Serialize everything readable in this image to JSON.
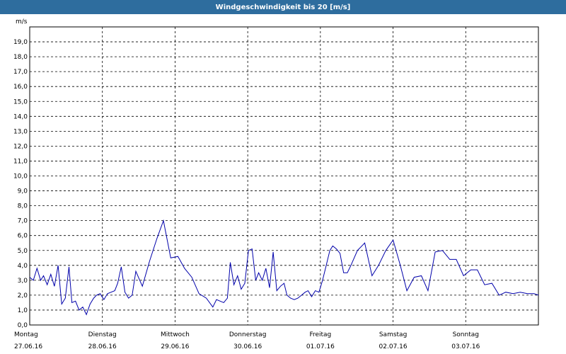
{
  "header": {
    "title": "Windgeschwindigkeit bis 20 [m/s]"
  },
  "chart_data": {
    "type": "line",
    "title": "Windgeschwindigkeit bis 20 [m/s]",
    "ylabel": "m/s",
    "ylim": [
      0,
      20
    ],
    "yticks": [
      "0,0",
      "1,0",
      "2,0",
      "3,0",
      "4,0",
      "5,0",
      "6,0",
      "7,0",
      "8,0",
      "9,0",
      "10,0",
      "11,0",
      "12,0",
      "13,0",
      "14,0",
      "15,0",
      "16,0",
      "17,0",
      "18,0",
      "19,0"
    ],
    "xlim": [
      0,
      7
    ],
    "days": [
      {
        "weekday": "Montag",
        "date": "27.06.16"
      },
      {
        "weekday": "Dienstag",
        "date": "28.06.16"
      },
      {
        "weekday": "Mittwoch",
        "date": "29.06.16"
      },
      {
        "weekday": "Donnerstag",
        "date": "30.06.16"
      },
      {
        "weekday": "Freitag",
        "date": "01.07.16"
      },
      {
        "weekday": "Samstag",
        "date": "02.07.16"
      },
      {
        "weekday": "Sonntag",
        "date": "03.07.16"
      }
    ],
    "grid": true,
    "line_color": "#0000aa",
    "series": [
      {
        "x": [
          0.0,
          0.05,
          0.1,
          0.15,
          0.19,
          0.24,
          0.29,
          0.34,
          0.39,
          0.44,
          0.49,
          0.54,
          0.58,
          0.63,
          0.68,
          0.73,
          0.78,
          0.83,
          0.88,
          0.92,
          0.97,
          1.02,
          1.07,
          1.12,
          1.17,
          1.21,
          1.26,
          1.31,
          1.36,
          1.41,
          1.46,
          1.55,
          1.65,
          1.75,
          1.84,
          1.94,
          2.04,
          2.13,
          2.23,
          2.33,
          2.43,
          2.52,
          2.57,
          2.62,
          2.67,
          2.72,
          2.76,
          2.81,
          2.86,
          2.91,
          2.96,
          3.01,
          3.06,
          3.11,
          3.15,
          3.2,
          3.25,
          3.3,
          3.35,
          3.4,
          3.45,
          3.5,
          3.54,
          3.59,
          3.64,
          3.69,
          3.74,
          3.79,
          3.83,
          3.88,
          3.93,
          3.98,
          4.03,
          4.08,
          4.13,
          4.17,
          4.22,
          4.27,
          4.32,
          4.37,
          4.42,
          4.51,
          4.61,
          4.71,
          4.8,
          4.9,
          5.0,
          5.1,
          5.19,
          5.29,
          5.39,
          5.48,
          5.58,
          5.68,
          5.78,
          5.87,
          5.97,
          6.07,
          6.16,
          6.26,
          6.36,
          6.46,
          6.55,
          6.65,
          6.75,
          6.85,
          6.94,
          7.0
        ],
        "y": [
          3.2,
          3.0,
          3.8,
          3.0,
          3.3,
          2.7,
          3.4,
          2.6,
          4.0,
          1.4,
          1.8,
          3.9,
          1.5,
          1.6,
          1.0,
          1.2,
          0.7,
          1.4,
          1.8,
          2.0,
          2.1,
          1.7,
          2.1,
          2.2,
          2.3,
          2.8,
          3.9,
          2.2,
          1.8,
          2.0,
          3.6,
          2.6,
          4.3,
          5.8,
          7.0,
          4.5,
          4.6,
          3.8,
          3.2,
          2.1,
          1.8,
          1.2,
          1.7,
          1.6,
          1.5,
          1.8,
          4.2,
          2.7,
          3.3,
          2.4,
          2.8,
          5.0,
          5.1,
          3.0,
          3.5,
          3.0,
          3.8,
          2.5,
          4.9,
          2.3,
          2.6,
          2.8,
          2.0,
          1.8,
          1.7,
          1.8,
          2.0,
          2.2,
          2.3,
          1.9,
          2.3,
          2.2,
          3.0,
          4.0,
          5.0,
          5.3,
          5.1,
          4.8,
          3.5,
          3.5,
          4.0,
          5.0,
          5.5,
          3.3,
          4.0,
          5.0,
          5.7,
          4.0,
          2.3,
          3.2,
          3.3,
          2.3,
          4.9,
          5.0,
          4.4,
          4.4,
          3.3,
          3.7,
          3.7,
          2.7,
          2.8,
          2.0,
          2.2,
          2.1,
          2.2,
          2.1,
          2.1,
          2.0
        ]
      }
    ]
  }
}
